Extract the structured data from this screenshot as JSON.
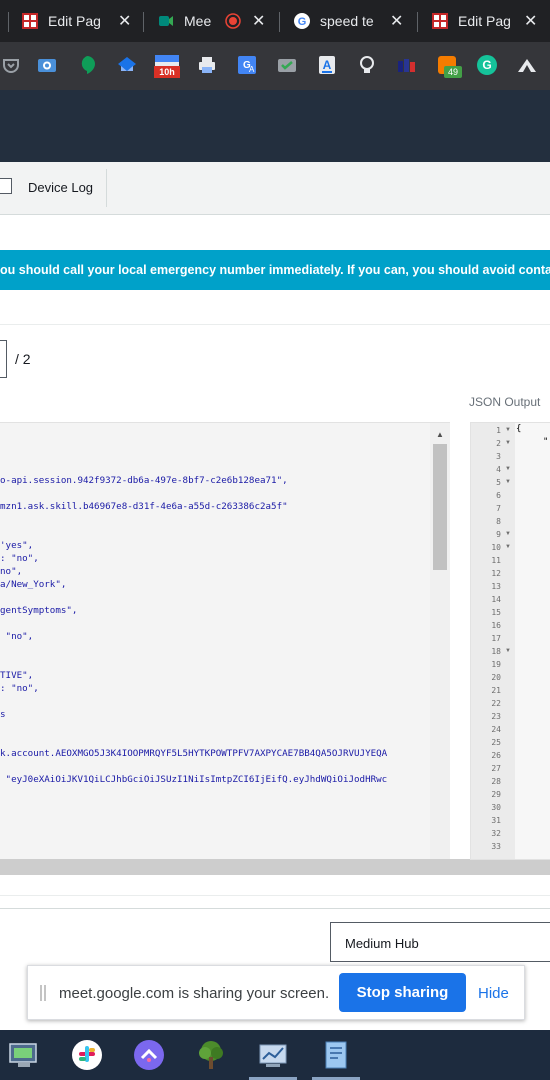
{
  "browser": {
    "tabs": [
      {
        "title": "Edit Pag",
        "close": "✕"
      },
      {
        "title": "Mee",
        "close": "✕"
      },
      {
        "title": "speed te",
        "close": "✕"
      },
      {
        "title": "Edit Pag",
        "close": "✕"
      }
    ],
    "extensions": [
      {
        "icon": "pocket-icon",
        "badge": ""
      },
      {
        "icon": "camera-icon",
        "badge": ""
      },
      {
        "icon": "hangouts-icon",
        "badge": ""
      },
      {
        "icon": "bookmark-icon",
        "badge": ""
      },
      {
        "icon": "calendar-icon",
        "badge": "10h"
      },
      {
        "icon": "printer-icon",
        "badge": ""
      },
      {
        "icon": "translate-icon",
        "badge": ""
      },
      {
        "icon": "mail-check-icon",
        "badge": ""
      },
      {
        "icon": "font-icon",
        "badge": ""
      },
      {
        "icon": "bulb-icon",
        "badge": ""
      },
      {
        "icon": "books-icon",
        "badge": ""
      },
      {
        "icon": "puzzle-icon",
        "badge": "49"
      },
      {
        "icon": "grammarly-icon",
        "badge": ""
      },
      {
        "icon": "mountain-icon",
        "badge": ""
      }
    ]
  },
  "toolbar": {
    "device_log_label": "Device Log"
  },
  "banner": {
    "text": "ou should call your local emergency number immediately. If you can, you should avoid contac"
  },
  "pagination": {
    "of_label": "/ 2"
  },
  "json_output": {
    "label": "JSON Output"
  },
  "code_lines": [
    "o-api.session.942f9372-db6a-497e-8bf7-c2e6b128ea71\",",
    "mzn1.ask.skill.b46967e8-d31f-4e6a-a55d-c263386c2a5f\"",
    "'yes\",",
    ": \"no\",",
    "no\",",
    "a/New_York\",",
    "gentSymptoms\",",
    " \"no\",",
    "TIVE\",",
    ": \"no\",",
    "s",
    "k.account.AEOXMGO5J3K4IOOPMRQYF5L5HYTKPOWTPFV7AXPYCAE7BB4QA5OJRVUJYEQA",
    " \"eyJ0eXAiOiJKV1QiLCJhbGciOiJSUzI1NiIsImtpZCI6IjEifQ.eyJhdWQiOiJodHRwc"
  ],
  "json_editor": {
    "line_numbers": [
      "1",
      "2",
      "3",
      "4",
      "5",
      "6",
      "7",
      "8",
      "9",
      "10",
      "11",
      "12",
      "13",
      "14",
      "15",
      "16",
      "17",
      "18",
      "19",
      "20",
      "21",
      "22",
      "23",
      "24",
      "25",
      "26",
      "27",
      "28",
      "29",
      "30",
      "31",
      "32",
      "33"
    ],
    "first_line_text": "{",
    "second_line_text": "\""
  },
  "hub_select": {
    "value": "Medium Hub"
  },
  "screen_share": {
    "message": "meet.google.com is sharing your screen.",
    "stop_label": "Stop sharing",
    "hide_label": "Hide"
  },
  "taskbar": {
    "apps": [
      "monitor-app-icon",
      "slack-icon",
      "clickup-icon",
      "tree-app-icon",
      "network-app-icon",
      "notepad-app-icon"
    ]
  }
}
